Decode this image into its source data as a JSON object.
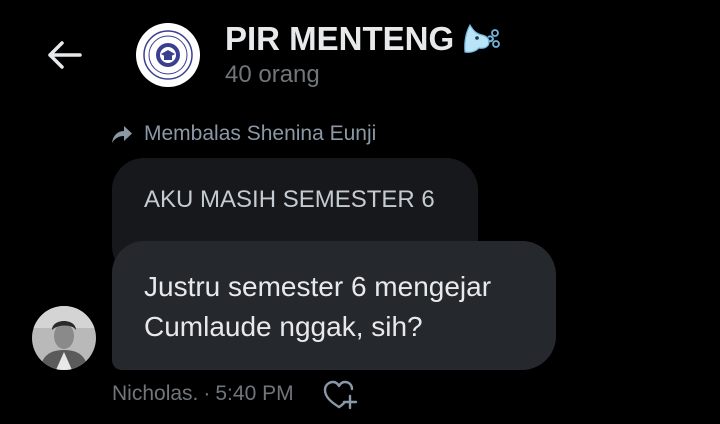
{
  "header": {
    "title": "PIR MENTENG",
    "title_emoji": "🌬️",
    "member_count": "40 orang"
  },
  "message": {
    "reply_label": "Membalas Shenina Eunji",
    "quoted_text": "AKU MASIH SEMESTER 6",
    "body_lines": [
      "Justru semester 6 mengejar",
      "Cumlaude nggak, sih?"
    ],
    "sender": "Nicholas.",
    "separator": "·",
    "time": "5:40 PM"
  },
  "icons": {
    "back": "arrow-left-icon",
    "reply": "reply-arrow-icon",
    "react": "heart-plus-icon"
  },
  "colors": {
    "background": "#000000",
    "bubble": "#25292e",
    "quoted_bubble": "#16181c",
    "muted_text": "#71767b"
  }
}
